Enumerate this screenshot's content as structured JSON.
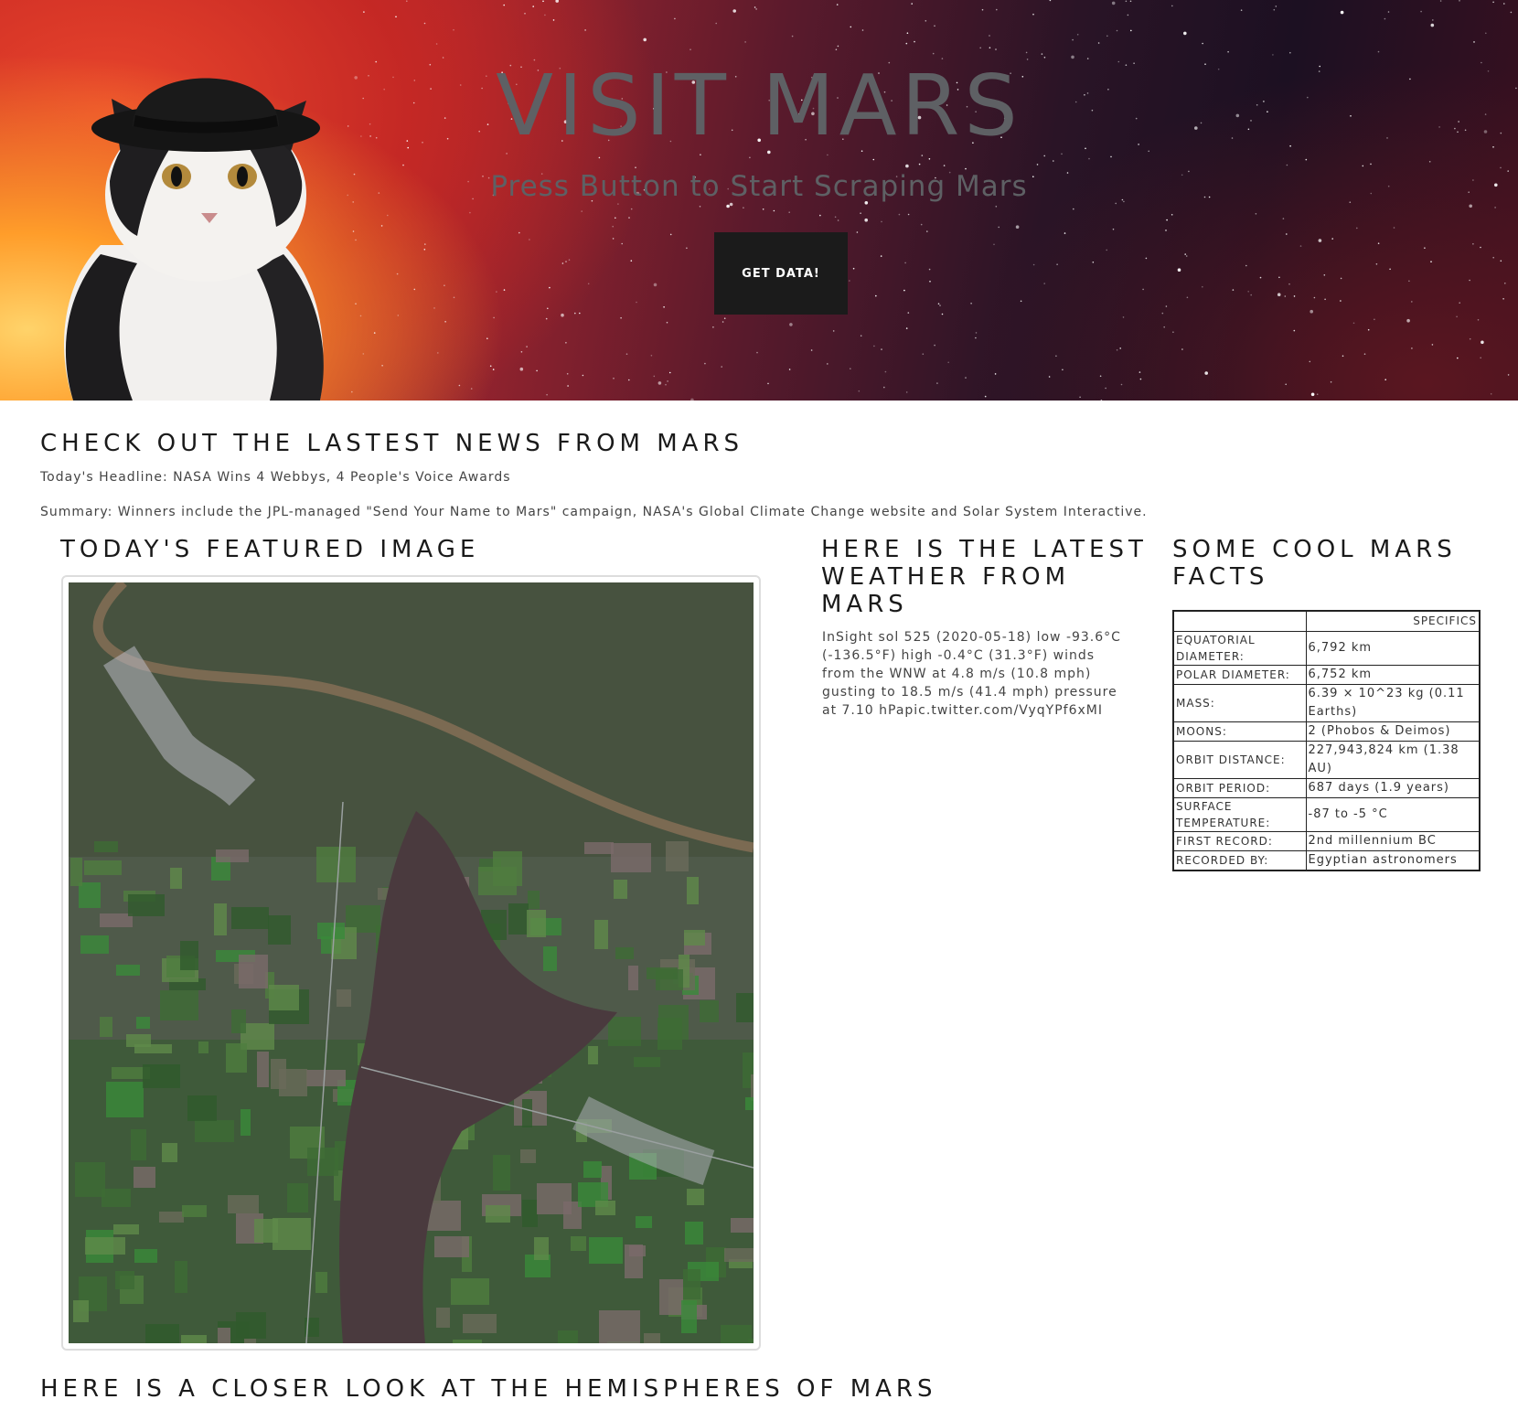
{
  "hero": {
    "title": "VISIT MARS",
    "subtitle": "Press Button to Start Scraping Mars",
    "button_label": "GET DATA!"
  },
  "news": {
    "heading": "CHECK OUT THE LASTEST NEWS FROM MARS",
    "headline": "Today's Headline: NASA Wins 4 Webbys, 4 People's Voice Awards",
    "summary": "Summary: Winners include the JPL-managed \"Send Your Name to Mars\" campaign, NASA's Global Climate Change website and Solar System Interactive."
  },
  "featured": {
    "heading": "TODAY'S FEATURED IMAGE"
  },
  "weather": {
    "heading_lines": [
      "HERE IS THE LATEST",
      "WEATHER FROM",
      "MARS"
    ],
    "text": "InSight sol 525 (2020-05-18) low -93.6°C (-136.5°F) high -0.4°C (31.3°F) winds from the WNW at 4.8 m/s (10.8 mph) gusting to 18.5 m/s (41.4 mph) pressure at 7.10 hPapic.twitter.com/VyqYPf6xMI"
  },
  "facts": {
    "heading_lines": [
      "SOME COOL MARS",
      "FACTS"
    ],
    "column_header": "SPECIFICS",
    "rows": [
      {
        "key": "Equatorial Diameter:",
        "value": "6,792 km"
      },
      {
        "key": "Polar Diameter:",
        "value": "6,752 km"
      },
      {
        "key": "Mass:",
        "value": "6.39 × 10^23 kg (0.11 Earths)"
      },
      {
        "key": "Moons:",
        "value": "2 (Phobos & Deimos)"
      },
      {
        "key": "Orbit Distance:",
        "value": "227,943,824 km (1.38 AU)"
      },
      {
        "key": "Orbit Period:",
        "value": "687 days (1.9 years)"
      },
      {
        "key": "Surface Temperature:",
        "value": "-87 to -5 °C"
      },
      {
        "key": "First Record:",
        "value": "2nd millennium BC"
      },
      {
        "key": "Recorded By:",
        "value": "Egyptian astronomers"
      }
    ]
  },
  "hemispheres": {
    "heading": "HERE IS A CLOSER LOOK AT THE HEMISPHERES OF MARS"
  }
}
